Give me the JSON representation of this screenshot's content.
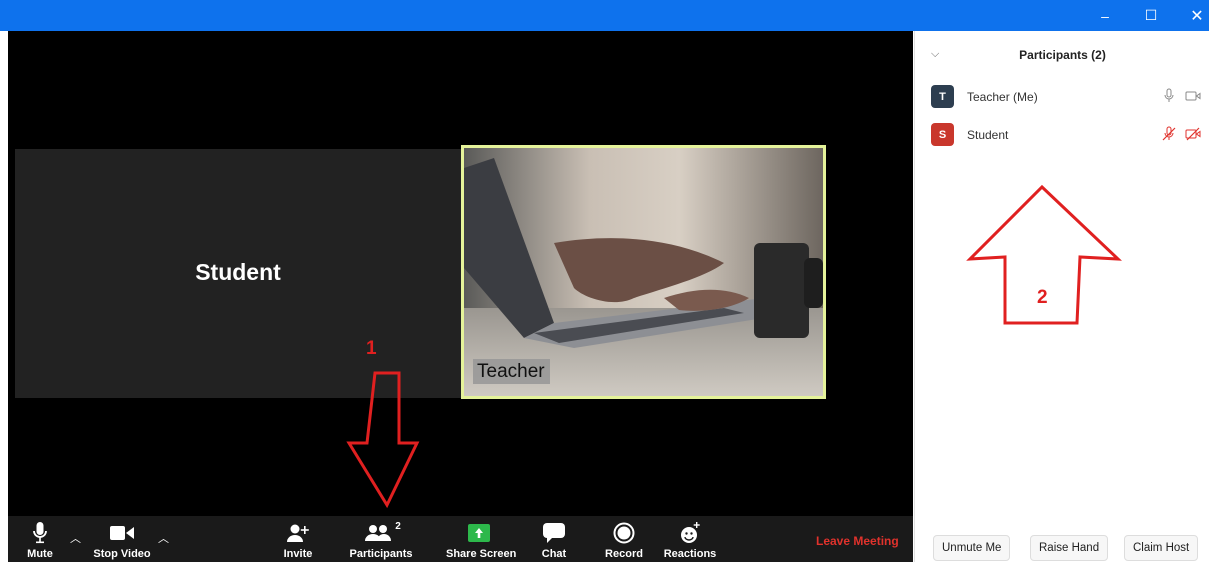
{
  "window": {
    "minimize_glyph": "–",
    "maximize_glyph": "☐",
    "close_glyph": "✕"
  },
  "meeting": {
    "student_tile_name": "Student",
    "teacher_tile_name": "Teacher"
  },
  "annotations": {
    "arrow1_label": "1",
    "arrow2_label": "2",
    "color": "#e02020"
  },
  "toolbar": {
    "mute_label": "Mute",
    "stop_video_label": "Stop Video",
    "invite_label": "Invite",
    "participants_label": "Participants",
    "participants_count": "2",
    "share_screen_label": "Share Screen",
    "chat_label": "Chat",
    "record_label": "Record",
    "reactions_label": "Reactions",
    "leave_label": "Leave Meeting",
    "share_color": "#2db84b",
    "leave_color": "#e0322c"
  },
  "panel": {
    "title": "Participants (2)",
    "participants": [
      {
        "initial": "T",
        "name": "Teacher (Me)",
        "avatar_color": "#2d3e50",
        "mic": "mic-icon",
        "video": "video-icon"
      },
      {
        "initial": "S",
        "name": "Student",
        "avatar_color": "#c9372c",
        "mic": "mic-muted-icon",
        "video": "video-off-icon"
      }
    ],
    "buttons": {
      "unmute": "Unmute Me",
      "raise_hand": "Raise Hand",
      "claim_host": "Claim Host"
    }
  }
}
